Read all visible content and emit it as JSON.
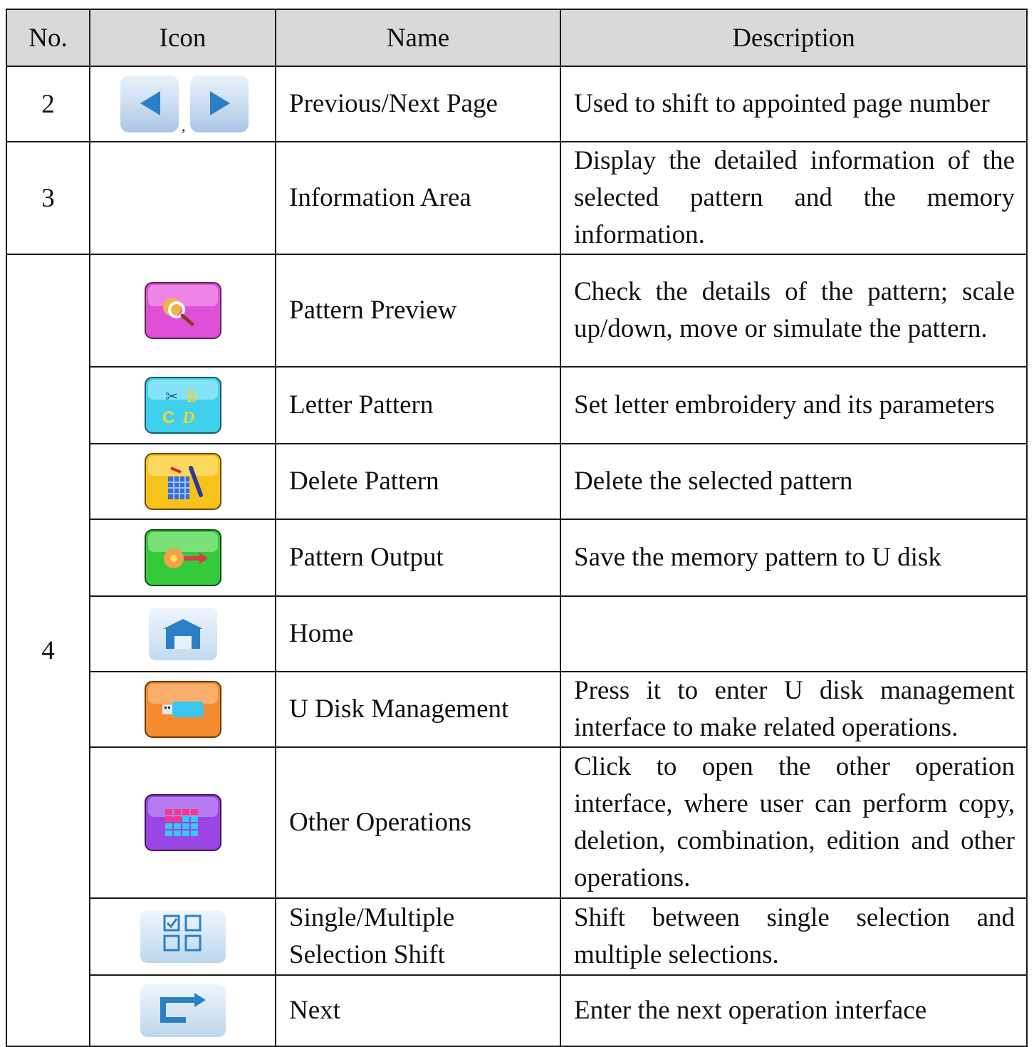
{
  "headers": {
    "no": "No.",
    "icon": "Icon",
    "name": "Name",
    "description": "Description"
  },
  "rows": [
    {
      "no": "2",
      "name": "Previous/Next Page",
      "description": "Used to shift to appointed page number",
      "icons": [
        "previous-page-icon",
        "next-page-icon"
      ],
      "separator": ","
    },
    {
      "no": "3",
      "name": "Information Area",
      "description": "Display the detailed information of the selected pattern and the memory information."
    },
    {
      "no": "4",
      "name": "Pattern Preview",
      "description": "Check the details of the pattern; scale up/down, move or simulate the pattern.",
      "icon": "pattern-preview-icon",
      "color": "#e04fd8"
    },
    {
      "name": "Letter Pattern",
      "description": "Set letter embroidery and its parameters",
      "icon": "letter-pattern-icon",
      "color": "#3fd0ee"
    },
    {
      "name": "Delete Pattern",
      "description": "Delete the selected pattern",
      "icon": "delete-pattern-icon",
      "color": "#f7c21c"
    },
    {
      "name": "Pattern Output",
      "description": "Save the memory pattern to U disk",
      "icon": "pattern-output-icon",
      "color": "#35c93c"
    },
    {
      "name": "Home",
      "description": "",
      "icon": "home-icon"
    },
    {
      "name": "U Disk Management",
      "description": "Press it to enter U disk management interface to make related operations.",
      "icon": "u-disk-icon",
      "color": "#f58a2f"
    },
    {
      "name": "Other Operations",
      "description": "Click to open the other operation interface, where user can perform copy, deletion, combination, edition and other operations.",
      "icon": "other-operations-icon",
      "color": "#9a45e6"
    },
    {
      "name_lines": [
        "Single/Multiple",
        "Selection Shift"
      ],
      "description": "Shift between single selection and multiple selections.",
      "icon": "selection-shift-icon"
    },
    {
      "name": "Next",
      "description": "Enter the next operation interface",
      "icon": "next-arrow-icon"
    }
  ]
}
